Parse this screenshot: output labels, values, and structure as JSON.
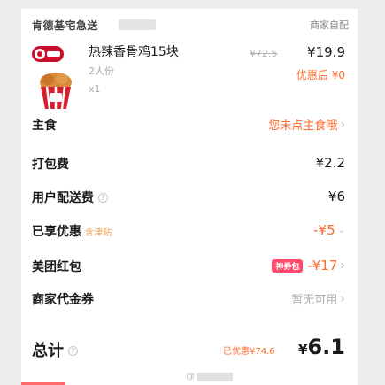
{
  "store": {
    "name": "肯德基宅急送",
    "delivery_badge": "商家自配"
  },
  "item": {
    "name": "热辣香骨鸡15块",
    "spec": "2人份",
    "quantity": "x1",
    "price_original": "¥72.5",
    "price_now": "¥19.9",
    "price_after_discount": "优惠后 ¥0",
    "logo_icon": "kfc-logo-icon",
    "image_icon": "fried-chicken-bucket-icon"
  },
  "rows": {
    "staple": {
      "label": "主食",
      "action": "您未点主食哦"
    },
    "packing": {
      "label": "打包费",
      "value": "¥2.2"
    },
    "delivery": {
      "label": "用户配送费",
      "value": "¥6"
    },
    "discount": {
      "label": "已享优惠",
      "tag": "含津贴",
      "value": "-¥5"
    },
    "red_packet": {
      "label": "美团红包",
      "tag": "神券包",
      "value": "-¥17"
    },
    "coupon": {
      "label": "商家代金券",
      "value": "暂无可用"
    }
  },
  "total": {
    "label": "总计",
    "discount_text": "已优惠¥74.6",
    "currency": "¥",
    "amount": "6.1"
  },
  "watermark": {
    "text": "@"
  },
  "colors": {
    "accent": "#ff6a2b",
    "red_tag": "#ff4a6e",
    "muted": "#b0b0b0"
  }
}
